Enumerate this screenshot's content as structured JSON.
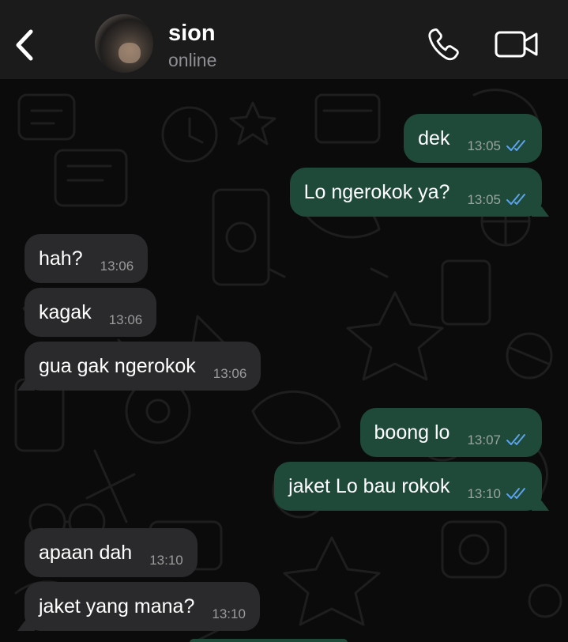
{
  "header": {
    "contact_name": "sion",
    "contact_status": "online"
  },
  "colors": {
    "outgoing_bubble": "#1f4a39",
    "incoming_bubble": "#2a2a2c",
    "read_ticks": "#5ba3ea",
    "header_bg": "#1b1b1b",
    "chat_bg": "#0b0b0b"
  },
  "icons": {
    "back": "chevron-left-icon",
    "call": "phone-icon",
    "video": "video-camera-icon",
    "read_receipt": "double-check-icon"
  },
  "messages": [
    {
      "direction": "out",
      "text": "dek",
      "time": "13:05",
      "read": true
    },
    {
      "direction": "out",
      "text": "Lo ngerokok ya?",
      "time": "13:05",
      "read": true
    },
    {
      "direction": "in",
      "text": "hah?",
      "time": "13:06"
    },
    {
      "direction": "in",
      "text": "kagak",
      "time": "13:06"
    },
    {
      "direction": "in",
      "text": "gua gak ngerokok",
      "time": "13:06"
    },
    {
      "direction": "out",
      "text": "boong lo",
      "time": "13:07",
      "read": true
    },
    {
      "direction": "out",
      "text": "jaket Lo bau rokok",
      "time": "13:10",
      "read": true
    },
    {
      "direction": "in",
      "text": "apaan dah",
      "time": "13:10"
    },
    {
      "direction": "in",
      "text": "jaket yang mana?",
      "time": "13:10"
    }
  ]
}
